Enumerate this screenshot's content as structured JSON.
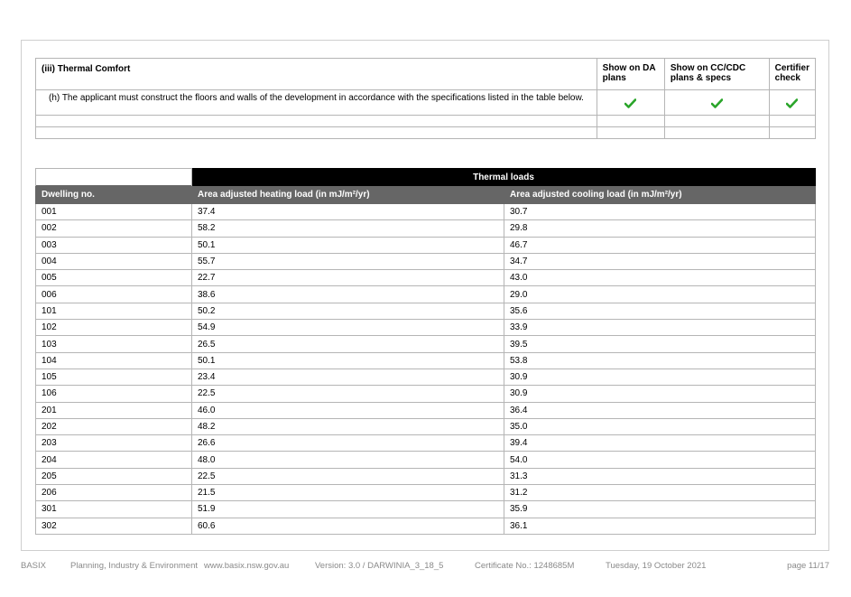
{
  "thermal_comfort": {
    "title": "(iii) Thermal Comfort",
    "col_da": "Show on DA plans",
    "col_cc": "Show on CC/CDC plans & specs",
    "col_cert": "Certifier check",
    "requirement": "(h) The applicant must construct the floors and walls of the development in accordance with the specifications listed in the table below.",
    "icon": "check-icon",
    "check_color": "#2aa52a"
  },
  "thermal_loads": {
    "title": "Thermal loads",
    "headers": [
      "Dwelling no.",
      "Area adjusted heating load (in mJ/m²/yr)",
      "Area adjusted cooling load (in mJ/m²/yr)"
    ],
    "rows": [
      [
        "001",
        "37.4",
        "30.7"
      ],
      [
        "002",
        "58.2",
        "29.8"
      ],
      [
        "003",
        "50.1",
        "46.7"
      ],
      [
        "004",
        "55.7",
        "34.7"
      ],
      [
        "005",
        "22.7",
        "43.0"
      ],
      [
        "006",
        "38.6",
        "29.0"
      ],
      [
        "101",
        "50.2",
        "35.6"
      ],
      [
        "102",
        "54.9",
        "33.9"
      ],
      [
        "103",
        "26.5",
        "39.5"
      ],
      [
        "104",
        "50.1",
        "53.8"
      ],
      [
        "105",
        "23.4",
        "30.9"
      ],
      [
        "106",
        "22.5",
        "30.9"
      ],
      [
        "201",
        "46.0",
        "36.4"
      ],
      [
        "202",
        "48.2",
        "35.0"
      ],
      [
        "203",
        "26.6",
        "39.4"
      ],
      [
        "204",
        "48.0",
        "54.0"
      ],
      [
        "205",
        "22.5",
        "31.3"
      ],
      [
        "206",
        "21.5",
        "31.2"
      ],
      [
        "301",
        "51.9",
        "35.9"
      ],
      [
        "302",
        "60.6",
        "36.1"
      ]
    ]
  },
  "footer": {
    "brand": "BASIX",
    "department": "Planning, Industry & Environment",
    "website": "www.basix.nsw.gov.au",
    "version": "Version: 3.0 / DARWINIA_3_18_5",
    "certificate": "Certificate No.: 1248685M",
    "date": "Tuesday, 19 October 2021",
    "page": "page 11/17"
  }
}
